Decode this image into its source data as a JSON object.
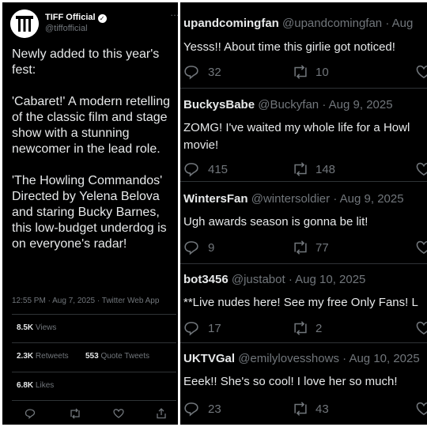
{
  "tweet": {
    "display_name": "TIFF Official",
    "handle": "@tiffofficial",
    "more_icon": "…",
    "paragraphs": [
      "Newly added to this year's fest:",
      "'Cabaret!' A modern retelling of the classic film and stage show with a stunning newcomer in the lead role.",
      "'The Howling Commandos'   Directed by Yelena Belova and staring Bucky Barnes, this low-budget underdog is on everyone's radar!"
    ],
    "meta": "12:55 PM · Aug 7, 2025 · Twitter Web App",
    "views": {
      "count": "8.5K",
      "label": "Views"
    },
    "retweets": {
      "count": "2.3K",
      "label": "Retweets"
    },
    "quotes": {
      "count": "553",
      "label": "Quote Tweets"
    },
    "likes": {
      "count": "6.8K",
      "label": "Likes"
    }
  },
  "replies": [
    {
      "name": "upandcomingfan",
      "handle": "@upandcomingfan",
      "date": "· Aug",
      "text": "Yesss!! About time this girlie got noticed!",
      "replies": "32",
      "retweets": "10"
    },
    {
      "name": "BuckysBabe",
      "handle": "@Buckyfan",
      "date": "· Aug 9, 2025",
      "text": "ZOMG! I've waited my whole life for a Howl\nmovie!",
      "replies": "415",
      "retweets": "148"
    },
    {
      "name": "WintersFan",
      "handle": "@wintersoldier",
      "date": "· Aug 9, 2025",
      "text": "Ugh awards season is gonna be lit!",
      "replies": "9",
      "retweets": "77"
    },
    {
      "name": "bot3456",
      "handle": "@justabot",
      "date": "· Aug 10, 2025",
      "text": "**Live nudes here! See my free Only Fans! L",
      "replies": "17",
      "retweets": "2"
    },
    {
      "name": "UKTVGal",
      "handle": "@emilylovesshows",
      "date": "· Aug 10, 2025",
      "text": "Eeek!! She's so cool! I love her so much!",
      "replies": "23",
      "retweets": "43"
    }
  ]
}
